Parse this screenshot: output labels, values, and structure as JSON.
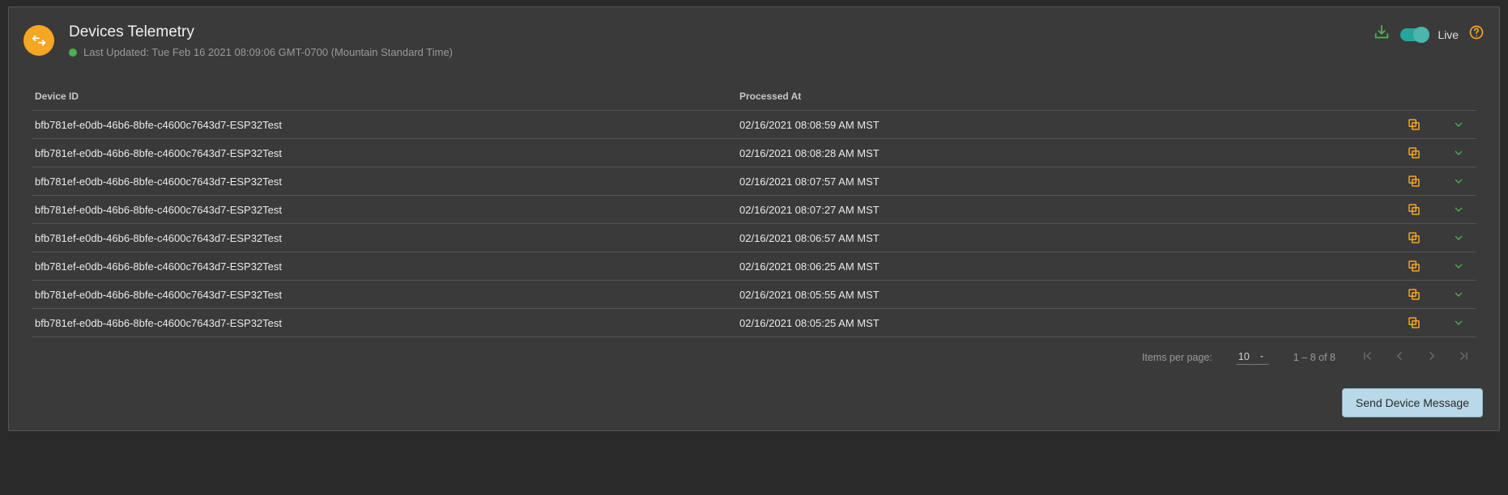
{
  "header": {
    "title": "Devices Telemetry",
    "last_updated": "Last Updated: Tue Feb 16 2021 08:09:06 GMT-0700 (Mountain Standard Time)",
    "live_label": "Live"
  },
  "columns": {
    "device_id": "Device ID",
    "processed_at": "Processed At"
  },
  "rows": [
    {
      "device_id": "bfb781ef-e0db-46b6-8bfe-c4600c7643d7-ESP32Test",
      "processed_at": "02/16/2021 08:08:59 AM MST"
    },
    {
      "device_id": "bfb781ef-e0db-46b6-8bfe-c4600c7643d7-ESP32Test",
      "processed_at": "02/16/2021 08:08:28 AM MST"
    },
    {
      "device_id": "bfb781ef-e0db-46b6-8bfe-c4600c7643d7-ESP32Test",
      "processed_at": "02/16/2021 08:07:57 AM MST"
    },
    {
      "device_id": "bfb781ef-e0db-46b6-8bfe-c4600c7643d7-ESP32Test",
      "processed_at": "02/16/2021 08:07:27 AM MST"
    },
    {
      "device_id": "bfb781ef-e0db-46b6-8bfe-c4600c7643d7-ESP32Test",
      "processed_at": "02/16/2021 08:06:57 AM MST"
    },
    {
      "device_id": "bfb781ef-e0db-46b6-8bfe-c4600c7643d7-ESP32Test",
      "processed_at": "02/16/2021 08:06:25 AM MST"
    },
    {
      "device_id": "bfb781ef-e0db-46b6-8bfe-c4600c7643d7-ESP32Test",
      "processed_at": "02/16/2021 08:05:55 AM MST"
    },
    {
      "device_id": "bfb781ef-e0db-46b6-8bfe-c4600c7643d7-ESP32Test",
      "processed_at": "02/16/2021 08:05:25 AM MST"
    }
  ],
  "paginator": {
    "items_per_page_label": "Items per page:",
    "items_per_page_value": "10",
    "range": "1 – 8 of 8"
  },
  "footer": {
    "send_button": "Send Device Message"
  }
}
